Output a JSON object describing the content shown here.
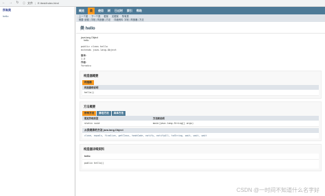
{
  "browser": {
    "address_label": "文件",
    "address_path": "E:/test/index.html"
  },
  "left_frame": {
    "header": "所有类",
    "classes": [
      "hello"
    ]
  },
  "topnav": {
    "items": [
      "概览",
      "类",
      "使用",
      "树",
      "已过时",
      "索引",
      "帮助"
    ]
  },
  "subnav": {
    "row1": [
      "上一个类",
      "下一个类",
      "框架",
      "无框架",
      "所有类"
    ],
    "row2": [
      "概要: 嵌套 | 字段 | 构造器 | 方法",
      "详细资料: 字段 | 构造器 | 方法"
    ]
  },
  "class_title": "类 hello",
  "hierarchy": {
    "parent": "java.lang.Object",
    "child": "hello"
  },
  "declaration": [
    "public class hello",
    "extends java.lang.Object"
  ],
  "version": {
    "label": "版本:",
    "value": "1.0"
  },
  "author": {
    "label": "作者:",
    "value": "Yorodzu"
  },
  "constructor_summary": {
    "heading": "构造器概要",
    "caption": "构造器",
    "col": "构造器和说明",
    "rows": [
      "hello()"
    ]
  },
  "method_summary": {
    "heading": "方法概要",
    "tabs": [
      "所有方法",
      "静态方法",
      "具体方法"
    ],
    "col1": "限定符和类型",
    "col2": "方法和说明",
    "rows": [
      {
        "modifier": "static void",
        "method": "main(java.lang.String[] args)"
      }
    ],
    "inherited_heading": "从类继承的方法 java.lang.Object",
    "inherited": "clone, equals, finalize, getClass, hashCode, notify, notifyAll, toString, wait, wait, wait"
  },
  "constructor_detail": {
    "heading": "构造器详细资料",
    "name": "hello",
    "signature": "public hello()"
  },
  "watermark": "CSDN @一时间不知道什么名字好"
}
